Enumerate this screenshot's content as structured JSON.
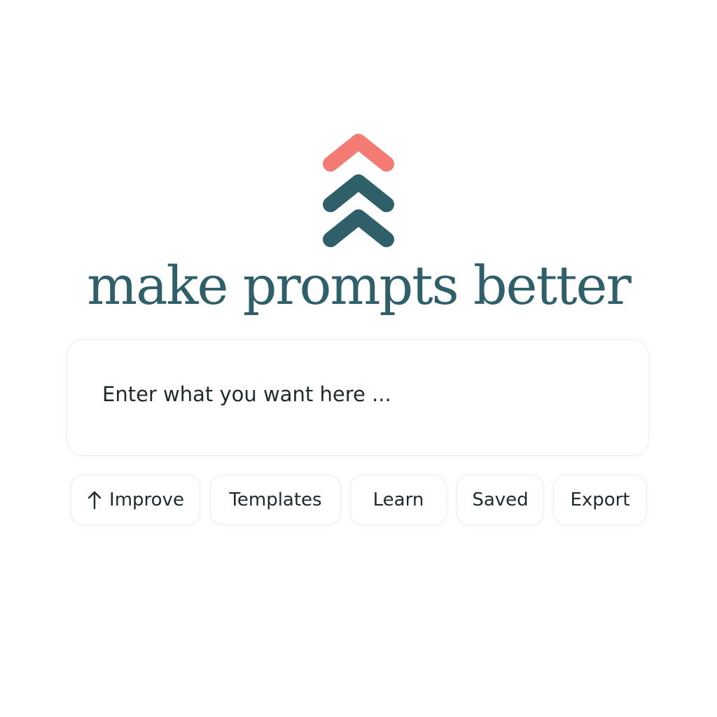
{
  "brand": {
    "headline": "make prompts better",
    "logo_icon": "triple-chevron-up-icon",
    "colors": {
      "accent": "#f47b74",
      "primary": "#2f5f69",
      "text": "#1f2a2e",
      "border": "#ececec"
    }
  },
  "prompt": {
    "placeholder": "Enter what you want here ...",
    "value": ""
  },
  "actions": {
    "improve": {
      "label": "Improve",
      "icon": "arrow-up-icon"
    },
    "templates": {
      "label": "Templates"
    },
    "learn": {
      "label": "Learn"
    },
    "saved": {
      "label": "Saved"
    },
    "export": {
      "label": "Export"
    }
  }
}
